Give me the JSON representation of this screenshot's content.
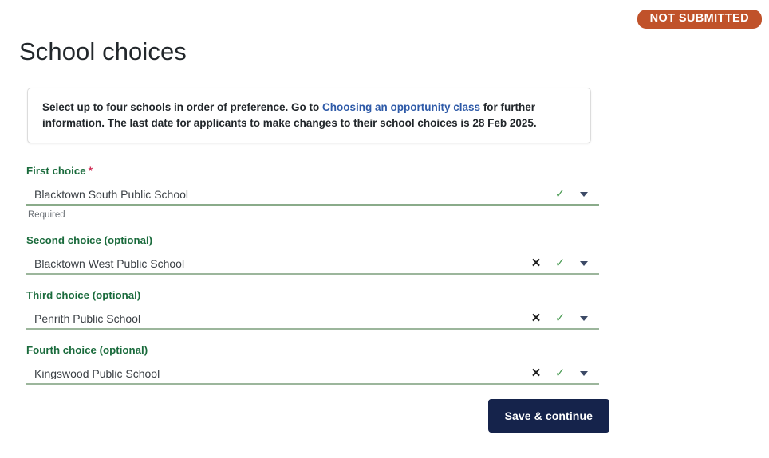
{
  "status": {
    "badge_label": "NOT SUBMITTED",
    "badge_color": "#c0522a"
  },
  "header": {
    "title": "School choices"
  },
  "info": {
    "text_before_link": "Select up to four schools in order of preference. Go to ",
    "link_label": "Choosing an opportunity class",
    "text_after_link": " for further information. The last date for applicants to make changes to their school choices is 28 Feb 2025.",
    "link_color": "#2e5aa8"
  },
  "form": {
    "fields": [
      {
        "label": "First choice",
        "required": true,
        "required_marker": "*",
        "value": "Blacktown South Public School",
        "helper": "Required",
        "has_clear": false,
        "valid_icon": "check-icon",
        "dropdown_icon": "chevron-down-icon"
      },
      {
        "label": "Second choice (optional)",
        "required": false,
        "required_marker": "",
        "value": "Blacktown West Public School",
        "helper": "",
        "has_clear": true,
        "valid_icon": "check-icon",
        "dropdown_icon": "chevron-down-icon"
      },
      {
        "label": "Third choice (optional)",
        "required": false,
        "required_marker": "",
        "value": "Penrith Public School",
        "helper": "",
        "has_clear": true,
        "valid_icon": "check-icon",
        "dropdown_icon": "chevron-down-icon"
      },
      {
        "label": "Fourth choice (optional)",
        "required": false,
        "required_marker": "",
        "value": "Kingswood Public School",
        "helper": "",
        "has_clear": true,
        "valid_icon": "check-icon",
        "dropdown_icon": "chevron-down-icon"
      }
    ],
    "clear_icon_glyph": "✕",
    "check_icon_glyph": "✓"
  },
  "actions": {
    "submit_label": "Save & continue",
    "submit_color": "#15234b"
  }
}
